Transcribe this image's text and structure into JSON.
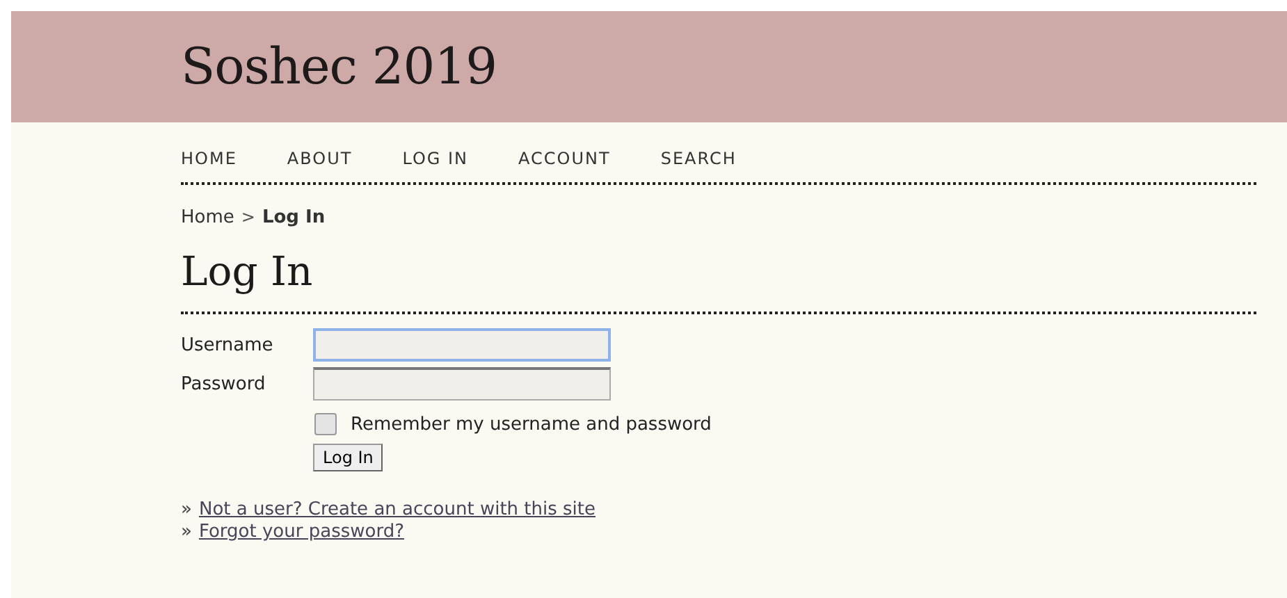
{
  "header": {
    "title": "Soshec 2019"
  },
  "nav": [
    "HOME",
    "ABOUT",
    "LOG IN",
    "ACCOUNT",
    "SEARCH"
  ],
  "breadcrumb": [
    {
      "label": "Home",
      "current": false
    },
    {
      "label": ">",
      "kind": "separator",
      "current": false
    },
    {
      "label": "Log In",
      "current": true
    }
  ],
  "heading": "Log In",
  "form": {
    "fields": [
      {
        "label": "Username",
        "focused": true
      },
      {
        "label": "Password",
        "focused": false
      }
    ],
    "remember": {
      "label": "Remember my username and password",
      "checked": false
    },
    "submit": "Log In"
  },
  "links": [
    {
      "bullet": "»",
      "text": "Not a user? Create an account with this site"
    },
    {
      "bullet": "»",
      "text": "Forgot your password?"
    }
  ]
}
